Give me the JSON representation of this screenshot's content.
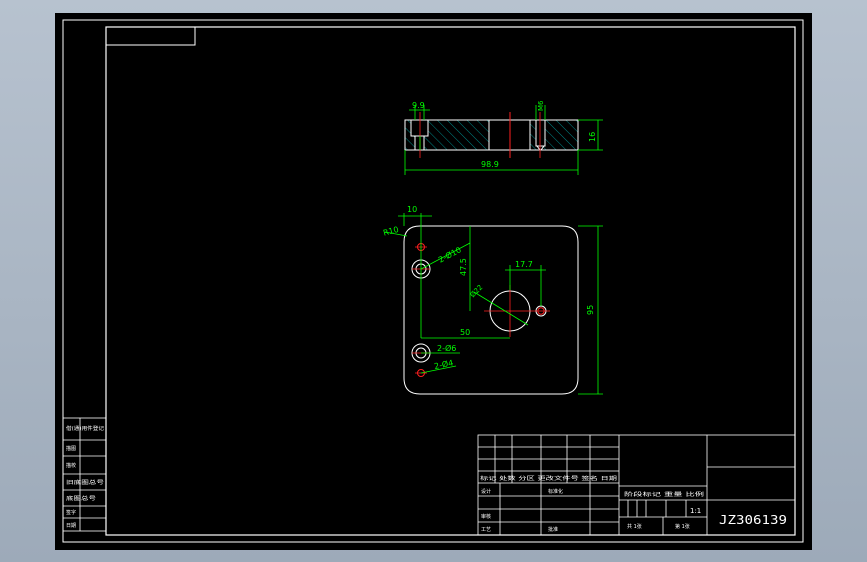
{
  "drawing": {
    "number": "JZ306139",
    "scale": "1:1",
    "colors": {
      "background": "#000000",
      "frame": "#ffffff",
      "dimension": "#00ff00",
      "centerline": "#ff2020",
      "hatch": "#00a0a0",
      "outer_backdrop": "#aab5c2"
    }
  },
  "section_view": {
    "dims": {
      "top_left": "9.9",
      "top_right": "M6",
      "height": "16",
      "length": "98.9"
    }
  },
  "plan_view": {
    "dims": {
      "offset_x": "10",
      "corner_radius": "R10",
      "hole_pair_large": "2-Ø10",
      "vertical": "47.5",
      "center_to_hole": "17.7",
      "center_bore": "Ø22",
      "hole_spacing": "50",
      "height": "95",
      "hole_pair_small_top": "2-Ø6",
      "hole_pair_small_bottom": "2-Ø4"
    }
  },
  "title_block": {
    "label_row1": "标记 处数 分区 更改文件号 签名 日期",
    "label_design": "设计",
    "label_standard": "标准化",
    "label_review": "审核",
    "label_craft": "工艺",
    "label_approve": "批准",
    "label_stage": "阶段标记 重量 比例",
    "sheet_count": "共 1张",
    "sheet_index": "第 1张"
  },
  "side_table": {
    "rows": [
      "借(通)用件登记",
      "描图",
      "描校",
      "旧底图总号",
      "底图总号",
      "签字",
      "日期"
    ]
  }
}
